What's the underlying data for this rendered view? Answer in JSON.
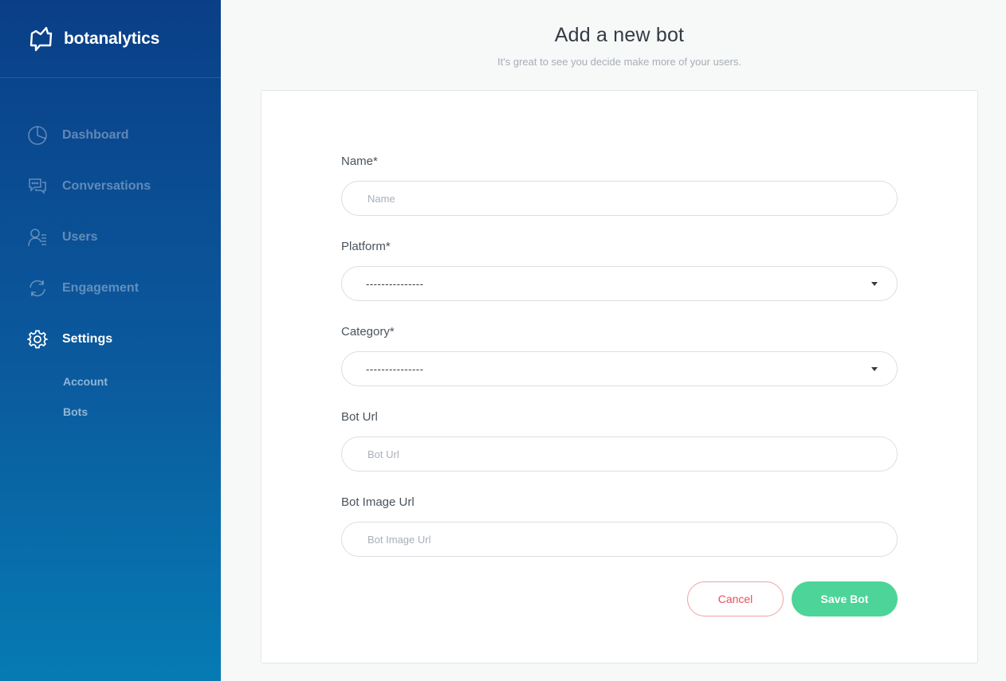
{
  "app": {
    "brand": "botanalytics"
  },
  "sidebar": {
    "items": [
      {
        "label": "Dashboard",
        "icon": "pie-chart-icon"
      },
      {
        "label": "Conversations",
        "icon": "chat-bubbles-icon"
      },
      {
        "label": "Users",
        "icon": "users-icon"
      },
      {
        "label": "Engagement",
        "icon": "refresh-icon"
      },
      {
        "label": "Settings",
        "icon": "gear-icon",
        "active": true
      }
    ],
    "sub_items": [
      {
        "label": "Account"
      },
      {
        "label": "Bots"
      }
    ]
  },
  "page": {
    "title": "Add a new bot",
    "subtitle": "It's great to see you decide make more of your users."
  },
  "form": {
    "name": {
      "label": "Name*",
      "placeholder": "Name",
      "value": ""
    },
    "platform": {
      "label": "Platform*",
      "value": "---------------"
    },
    "category": {
      "label": "Category*",
      "value": "---------------"
    },
    "bot_url": {
      "label": "Bot Url",
      "placeholder": "Bot Url",
      "value": ""
    },
    "bot_image_url": {
      "label": "Bot Image Url",
      "placeholder": "Bot Image Url",
      "value": ""
    }
  },
  "actions": {
    "cancel_label": "Cancel",
    "save_label": "Save Bot"
  },
  "colors": {
    "sidebar_top": "#0a3f87",
    "sidebar_bottom": "#067bb3",
    "save_button": "#4dd498",
    "cancel_text": "#e8505b",
    "cancel_border": "#f2a0a8"
  }
}
